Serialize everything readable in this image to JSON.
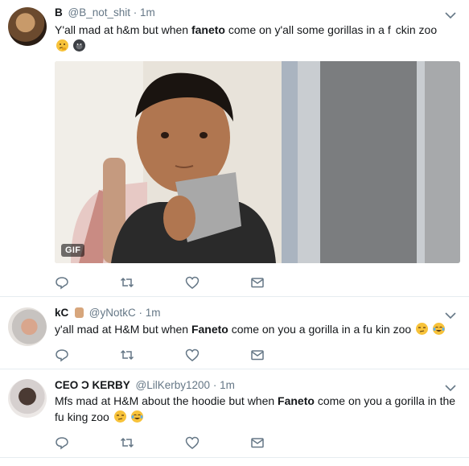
{
  "tweets": [
    {
      "name": "B",
      "handle": "@B_not_shit",
      "dot": "·",
      "time": "1m",
      "text_1": "Y'all mad at h&m but when ",
      "bold": "faneto",
      "text_2": "  come on  y'all some gorillas in a f",
      "text_3": "ckin zoo",
      "emojis": [
        "thinking-face",
        "gorilla"
      ],
      "media_badge": "GIF"
    },
    {
      "name": "kC",
      "handle": "@yNotkC",
      "dot": "·",
      "time": "1m",
      "text_1": "y'all mad at H&M but when ",
      "bold": "Faneto",
      "text_2": " come on you a gorilla in a fu",
      "text_3": "kin zoo",
      "emojis": [
        "unamused-face",
        "face-with-tears-of-joy"
      ]
    },
    {
      "name": "CEO Ɔ KERBY",
      "handle": "@LilKerby1200",
      "dot": "·",
      "time": "1m",
      "text_1": "Mfs mad at H&M about the hoodie but when ",
      "bold": "Faneto",
      "text_2": " come on you a gorilla in the",
      "text_3": "fu",
      "text_4": "king zoo",
      "emojis": [
        "unamused-face",
        "face-with-tears-of-joy"
      ]
    }
  ],
  "colors": {
    "icon_gray": "#657786",
    "divider": "#e6ecf0",
    "text": "#14171a"
  }
}
